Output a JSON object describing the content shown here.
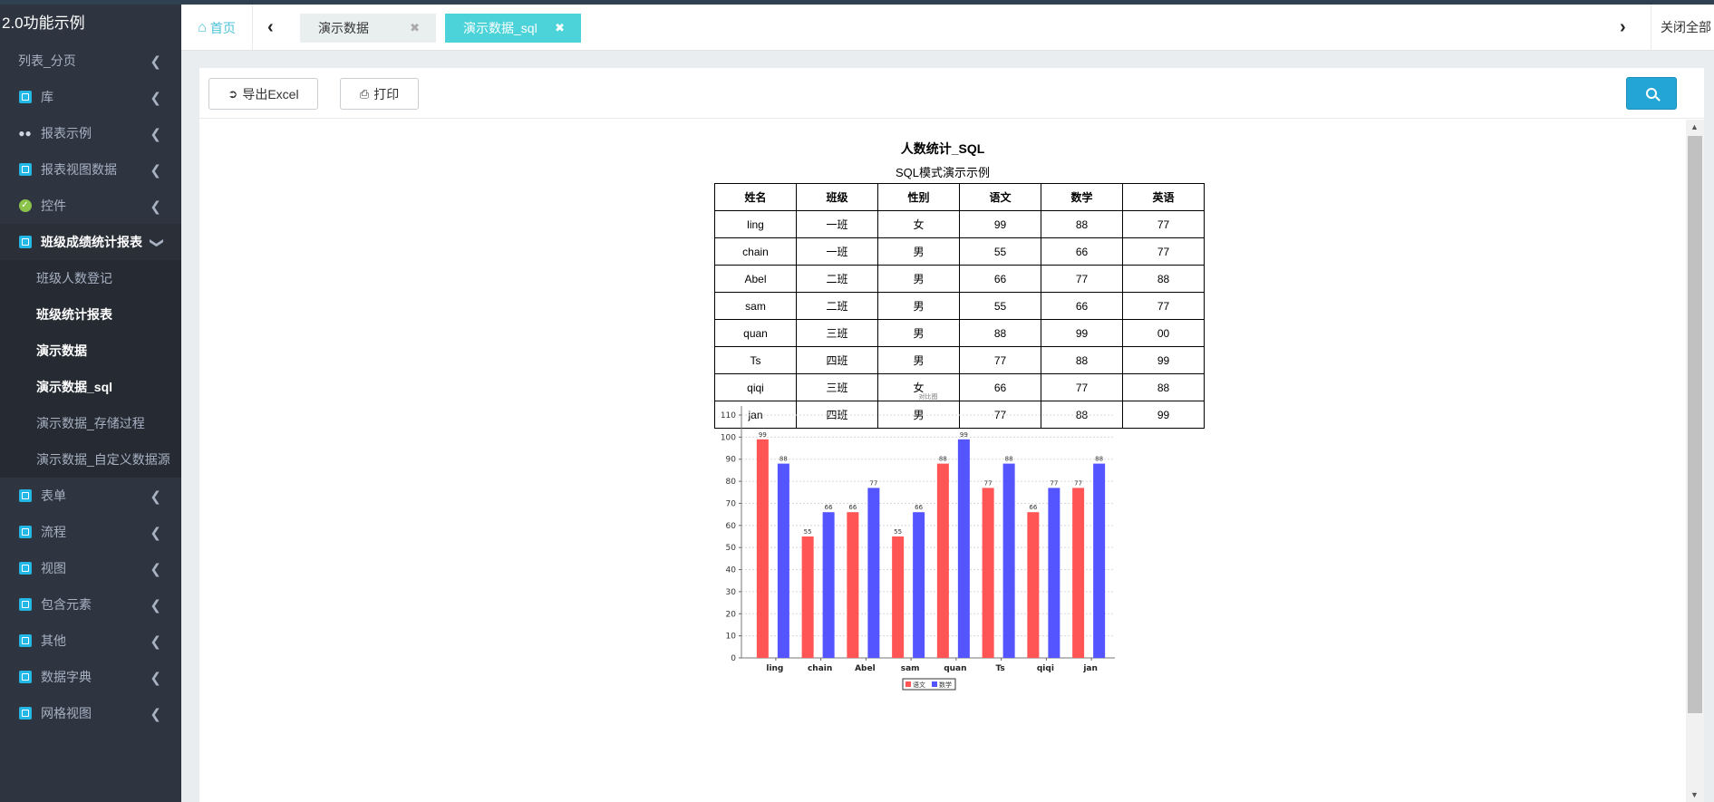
{
  "sidebar": {
    "brand": "2.0功能示例",
    "items": [
      {
        "label": "列表_分页",
        "icon": "none"
      },
      {
        "label": "库",
        "icon": "cube-icon"
      },
      {
        "label": "报表示例",
        "icon": "binoculars-icon"
      },
      {
        "label": "报表视图数据",
        "icon": "cube-icon"
      },
      {
        "label": "控件",
        "icon": "check-circle-icon"
      },
      {
        "label": "班级成绩统计报表",
        "icon": "cube-icon",
        "expanded": true
      }
    ],
    "submenu": [
      {
        "label": "班级人数登记"
      },
      {
        "label": "班级统计报表"
      },
      {
        "label": "演示数据"
      },
      {
        "label": "演示数据_sql"
      },
      {
        "label": "演示数据_存储过程"
      },
      {
        "label": "演示数据_自定义数据源"
      }
    ],
    "items_after": [
      {
        "label": "表单",
        "icon": "cube-icon"
      },
      {
        "label": "流程",
        "icon": "cube-icon"
      },
      {
        "label": "视图",
        "icon": "cube-icon"
      },
      {
        "label": "包含元素",
        "icon": "cube-icon"
      },
      {
        "label": "其他",
        "icon": "cube-icon"
      },
      {
        "label": "数据字典",
        "icon": "cube-icon"
      },
      {
        "label": "网格视图",
        "icon": "cube-icon"
      }
    ]
  },
  "tabs": {
    "home": "首页",
    "open": [
      {
        "label": "演示数据"
      },
      {
        "label": "演示数据_sql",
        "active": true
      }
    ],
    "close_all": "关闭全部"
  },
  "toolbar": {
    "export_label": "导出Excel",
    "print_label": "打印"
  },
  "report": {
    "title": "人数统计_SQL",
    "subtitle": "SQL模式演示示例",
    "columns": [
      "姓名",
      "班级",
      "性别",
      "语文",
      "数学",
      "英语"
    ],
    "rows": [
      [
        "ling",
        "一班",
        "女",
        "99",
        "88",
        "77"
      ],
      [
        "chain",
        "一班",
        "男",
        "55",
        "66",
        "77"
      ],
      [
        "Abel",
        "二班",
        "男",
        "66",
        "77",
        "88"
      ],
      [
        "sam",
        "二班",
        "男",
        "55",
        "66",
        "77"
      ],
      [
        "quan",
        "三班",
        "男",
        "88",
        "99",
        "00"
      ],
      [
        "Ts",
        "四班",
        "男",
        "77",
        "88",
        "99"
      ],
      [
        "qiqi",
        "三班",
        "女",
        "66",
        "77",
        "88"
      ],
      [
        "jan",
        "四班",
        "男",
        "77",
        "88",
        "99"
      ]
    ]
  },
  "chart_data": {
    "type": "bar",
    "title": "对比图",
    "categories": [
      "ling",
      "chain",
      "Abel",
      "sam",
      "quan",
      "Ts",
      "qiqi",
      "jan"
    ],
    "series": [
      {
        "name": "语文",
        "values": [
          99,
          55,
          66,
          55,
          88,
          77,
          66,
          77
        ],
        "color": "#ff5555"
      },
      {
        "name": "数学",
        "values": [
          88,
          66,
          77,
          66,
          99,
          88,
          77,
          88
        ],
        "color": "#5555ff"
      }
    ],
    "ylim": [
      0,
      110
    ],
    "yticks": [
      0,
      10,
      20,
      30,
      40,
      50,
      60,
      70,
      80,
      90,
      100,
      110
    ],
    "grid": true,
    "legend": "bottom"
  }
}
